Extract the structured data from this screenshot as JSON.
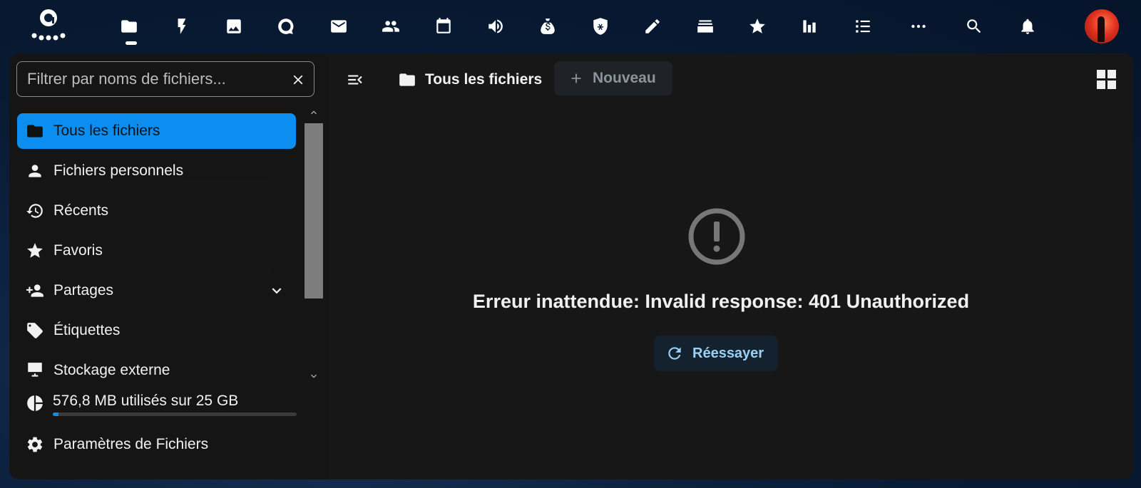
{
  "topbar": {
    "apps": [
      {
        "name": "files-icon"
      },
      {
        "name": "activity-icon"
      },
      {
        "name": "photos-icon"
      },
      {
        "name": "talk-icon"
      },
      {
        "name": "mail-icon"
      },
      {
        "name": "contacts-icon"
      },
      {
        "name": "calendar-icon"
      },
      {
        "name": "announcements-icon"
      },
      {
        "name": "money-bag-icon"
      },
      {
        "name": "passwords-icon"
      },
      {
        "name": "notes-icon"
      },
      {
        "name": "deck-icon"
      },
      {
        "name": "bookmarks-icon"
      },
      {
        "name": "analytics-icon"
      },
      {
        "name": "tasks-icon"
      },
      {
        "name": "more-apps-icon"
      }
    ]
  },
  "sidebar": {
    "filter_placeholder": "Filtrer par noms de fichiers...",
    "items": [
      {
        "label": "Tous les fichiers"
      },
      {
        "label": "Fichiers personnels"
      },
      {
        "label": "Récents"
      },
      {
        "label": "Favoris"
      },
      {
        "label": "Partages"
      },
      {
        "label": "Étiquettes"
      },
      {
        "label": "Stockage externe"
      }
    ],
    "quota": {
      "label": "576,8 MB utilisés sur 25 GB",
      "used_percent": 2.3
    },
    "settings_label": "Paramètres de Fichiers"
  },
  "main": {
    "breadcrumb": "Tous les fichiers",
    "new_label": "Nouveau",
    "error_message": "Erreur inattendue: Invalid response: 401 Unauthorized",
    "retry_label": "Réessayer"
  },
  "colors": {
    "accent": "#0b8ef0",
    "background": "#171717",
    "retry_text": "#9bd0f5"
  }
}
